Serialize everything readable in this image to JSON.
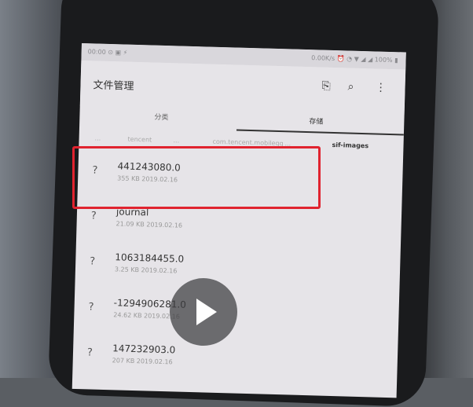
{
  "app": {
    "title": "文件管理"
  },
  "statusbar": {
    "left": "00:00 ⊙ ▣ ⚡",
    "right": "0.00K/s ⏰ ◔ ▼ ◢ ◢ 100% ▮"
  },
  "toolbar": {
    "new_icon": "new-file-icon",
    "search_icon": "search-icon",
    "more_icon": "more-icon"
  },
  "tabs": [
    {
      "label": "分类"
    },
    {
      "label": "存储"
    }
  ],
  "breadcrumb": [
    {
      "label": "..."
    },
    {
      "label": "tencent"
    },
    {
      "label": "..."
    },
    {
      "label": "com.tencent.mobileqq"
    },
    {
      "label": "..."
    },
    {
      "label": "sif-images"
    }
  ],
  "files": [
    {
      "icon": "?",
      "name": "441243080.0",
      "meta": "355 KB  2019.02.16"
    },
    {
      "icon": "?",
      "name": "journal",
      "meta": "21.09 KB  2019.02.16"
    },
    {
      "icon": "?",
      "name": "1063184455.0",
      "meta": "3.25 KB  2019.02.16"
    },
    {
      "icon": "?",
      "name": "-1294906281.0",
      "meta": "24.62 KB  2019.02.16"
    },
    {
      "icon": "?",
      "name": "147232903.0",
      "meta": "207 KB  2019.02.16"
    }
  ],
  "overlay": {
    "play_icon": "play-icon",
    "highlight_color": "#e0232f"
  }
}
